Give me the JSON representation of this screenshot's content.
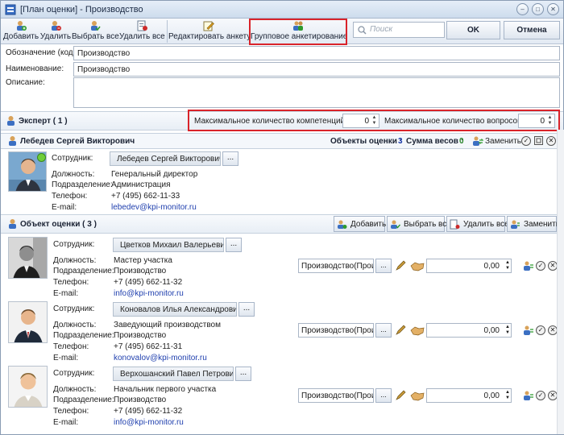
{
  "window": {
    "title": "[План оценки] - Производство",
    "controls": [
      "–",
      "□",
      "✕"
    ]
  },
  "toolbar": {
    "add": "Добавить",
    "delete": "Удалить",
    "select_all": "Выбрать все",
    "delete_all": "Удалить все",
    "edit_form": "Редактировать анкету",
    "group_survey": "Групповое анкетирование",
    "search_placeholder": "Поиск",
    "ok": "OK",
    "cancel": "Отмена"
  },
  "form": {
    "code_label": "Обозначение (код):",
    "code_value": "Производство",
    "name_label": "Наименование:",
    "name_value": "Производство",
    "desc_label": "Описание:",
    "desc_value": ""
  },
  "expert_section": {
    "title": "Эксперт ( 1 )",
    "max_competencies_label": "Максимальное количество компетенций :",
    "max_competencies_value": "0",
    "max_questions_label": "Максимальное количество вопросов :",
    "max_questions_value": "0"
  },
  "expert": {
    "name": "Лебедев Сергей Викторович",
    "objects_label": "Объекты оценки :",
    "objects_count": "3",
    "weights_label": "Сумма весов :",
    "weights_value": "0",
    "replace_label": "Заменить",
    "employee_label": "Сотрудник:",
    "employee_value": "Лебедев Сергей Викторович",
    "position_label": "Должность:",
    "position_value": "Генеральный директор",
    "dept_label": "Подразделение:",
    "dept_value": "Администрация",
    "phone_label": "Телефон:",
    "phone_value": "+7 (495) 662-11-33",
    "email_label": "E-mail:",
    "email_value": "lebedev@kpi-monitor.ru"
  },
  "objects_section": {
    "title": "Объект оценки ( 3 )",
    "add": "Добавить",
    "select_all": "Выбрать все",
    "delete_all": "Удалить все",
    "replace": "Заменить"
  },
  "objects": [
    {
      "employee_label": "Сотрудник:",
      "employee": "Цветков Михаил Валерьевич",
      "position_label": "Должность:",
      "position": "Мастер участка",
      "dept_label": "Подразделение:",
      "dept": "Производство",
      "phone_label": "Телефон:",
      "phone": "+7 (495) 662-11-32",
      "email_label": "E-mail:",
      "email": "info@kpi-monitor.ru",
      "plan": "Производство(Прои",
      "weight": "0,00"
    },
    {
      "employee_label": "Сотрудник:",
      "employee": "Коновалов Илья Александрович",
      "position_label": "Должность:",
      "position": "Заведующий производством",
      "dept_label": "Подразделение:",
      "dept": "Производство",
      "phone_label": "Телефон:",
      "phone": "+7 (495) 662-11-31",
      "email_label": "E-mail:",
      "email": "konovalov@kpi-monitor.ru",
      "plan": "Производство(Прои",
      "weight": "0,00"
    },
    {
      "employee_label": "Сотрудник:",
      "employee": "Верхошанский Павел Петрович",
      "position_label": "Должность:",
      "position": "Начальник первого участка",
      "dept_label": "Подразделение:",
      "dept": "Производство",
      "phone_label": "Телефон:",
      "phone": "+7 (495) 662-11-32",
      "email_label": "E-mail:",
      "email": "info@kpi-monitor.ru",
      "plan": "Производство(Прои",
      "weight": "0,00"
    }
  ],
  "colors": {
    "accent_link": "#1f3fae",
    "highlight": "#d9232a",
    "count_blue": "#1f3fae",
    "count_green": "#2d8a2d"
  }
}
